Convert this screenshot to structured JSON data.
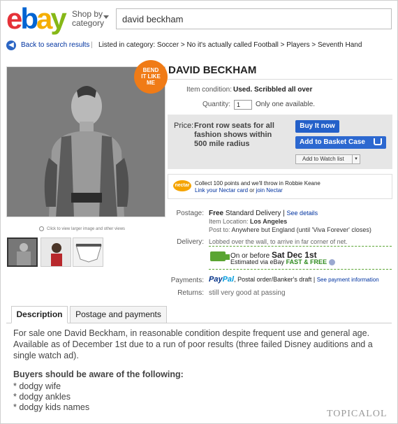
{
  "header": {
    "logo_letters": [
      "e",
      "b",
      "a",
      "y"
    ],
    "shop_by_line1": "Shop by",
    "shop_by_line2": "category",
    "search_value": "david beckham"
  },
  "breadcrumb": {
    "back_label": "Back to search results",
    "separator": "|",
    "path": "Listed in category: Soccer  >  No it's actually called Football  >  Players  >  Seventh Hand"
  },
  "badge": {
    "line1": "BEND",
    "line2": "IT LIKE",
    "line3": "ME"
  },
  "image_panel": {
    "zoom_hint": "Click to view larger image and other views",
    "thumbnail_count": 3
  },
  "listing": {
    "title": "DAVID BECKHAM",
    "condition_label": "Item condition:",
    "condition_value": "Used. Scribbled all over",
    "quantity_label": "Quantity:",
    "quantity_value": "1",
    "quantity_note": "Only one available.",
    "price_label": "Price:",
    "price_value": "Front row seats for all fashion shows within 500 mile radius",
    "buy_now": "Buy It now",
    "add_basket": "Add to Basket Case",
    "add_watch": "Add to Watch list",
    "watch_caret": "▾"
  },
  "nectar": {
    "logo": "nectar",
    "line1": "Collect 100 points and we'll throw in Robbie Keane",
    "link1": "Link your Nectar card",
    "or": " or ",
    "link2": "join Nectar"
  },
  "postage": {
    "label": "Postage:",
    "free": "Free",
    "method": " Standard Delivery | ",
    "see_details": "See details",
    "location_label": "Item Location:",
    "location_value": "Los Angeles",
    "post_to_label": "Post to:",
    "post_to_value": "Anywhere but England (until 'Viva Forever' closes)"
  },
  "delivery": {
    "label": "Delivery:",
    "note": "Lobbed over the wall, to arrive in far corner of net.",
    "on_or_before": "On or before",
    "date": "Sat Dec 1st",
    "estimated": "Estimated via eBay",
    "fast_free": "FAST & FREE"
  },
  "payments": {
    "label": "Payments:",
    "paypal_pay": "Pay",
    "paypal_pal": "Pal",
    "other": ", Postal order/Banker's draft | ",
    "see_info": "See payment information"
  },
  "returns": {
    "label": "Returns:",
    "value": "still very good at passing"
  },
  "tabs": {
    "description": "Description",
    "postage": "Postage and payments"
  },
  "description": {
    "para": "For sale one David Beckham, in reasonable condition despite frequent use and general age. Available as of December 1st due to a run of poor results (three failed Disney auditions and a single watch ad).",
    "heading": "Buyers should be aware of the following:",
    "bullets": [
      "* dodgy wife",
      "* dodgy ankles",
      "* dodgy kids names"
    ]
  },
  "watermark": "TOPICALOL",
  "colors": {
    "ebay_e": "#e53238",
    "ebay_b": "#0064d2",
    "ebay_a": "#f5af02",
    "ebay_y": "#86b817",
    "link": "#0033a0",
    "button_blue": "#2460c9",
    "badge_orange": "#f07b16",
    "free_green": "#2e8b1e"
  }
}
